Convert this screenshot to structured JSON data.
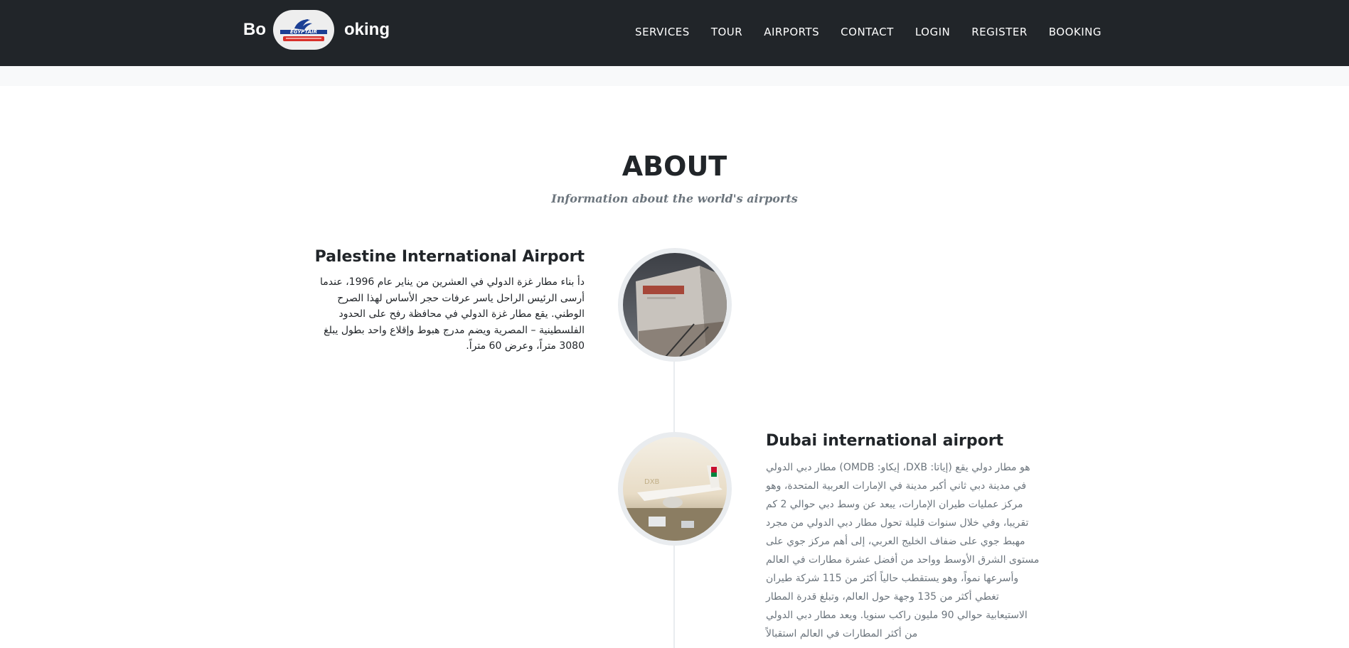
{
  "navbar": {
    "brand_prefix": "Bo",
    "brand_suffix": "oking",
    "logo_alt": "EgyptAir logo",
    "links": [
      {
        "label": "SERVICES"
      },
      {
        "label": "TOUR"
      },
      {
        "label": "AIRPORTS"
      },
      {
        "label": "CONTACT"
      },
      {
        "label": "LOGIN"
      },
      {
        "label": "REGISTER"
      },
      {
        "label": "BOOKING"
      }
    ]
  },
  "about": {
    "heading": "ABOUT",
    "subheading": "Information about the world's airports"
  },
  "timeline": [
    {
      "title": "Palestine International Airport",
      "body": "دأ بناء مطار غزة الدولي في العشرين من يناير عام 1996، عندما أرسى الرئيس الراحل ياسر عرفات حجر الأساس لهذا الصرح الوطني. يقع مطار غزة الدولي في محافظة رفح على الحدود الفلسطينية – المصرية ويضم مدرج هبوط وإقلاع واحد بطول يبلغ 3080 متراً، وعرض 60 متراً.",
      "image_icon": "airport-terminal-image"
    },
    {
      "title": "Dubai international airport",
      "body": "هو مطار دولي يقع (إياتا: DXB، إيكاو: OMDB) مطار دبي الدولي في مدينة دبي ثاني أكبر مدينة في الإمارات العربية المتحدة، وهو مركز عمليات طيران الإمارات، يبعد عن وسط دبي حوالي 2 كم تقريبا، وفي خلال سنوات قليلة تحول مطار دبي الدولي من مجرد مهبط جوي على ضفاف الخليج العربي، إلى أهم مركز جوي على مستوى الشرق الأوسط وواحد من أفضل عشرة مطارات في العالم وأسرعها نمواً، وهو يستقطب حالياً أكثر من 115 شركة طيران تغطي أكثر من 135 وجهة حول العالم، وتبلغ قدرة المطار الاستيعابية حوالي 90 مليون راكب سنويا. ويعد مطار دبي الدولي من أكثر المطارات في العالم استقبالاً",
      "image_icon": "emirates-plane-image"
    }
  ],
  "colors": {
    "navbar_bg": "#212529",
    "heading": "#212529",
    "muted": "#6c757d",
    "timeline_line": "#e9ecef"
  }
}
